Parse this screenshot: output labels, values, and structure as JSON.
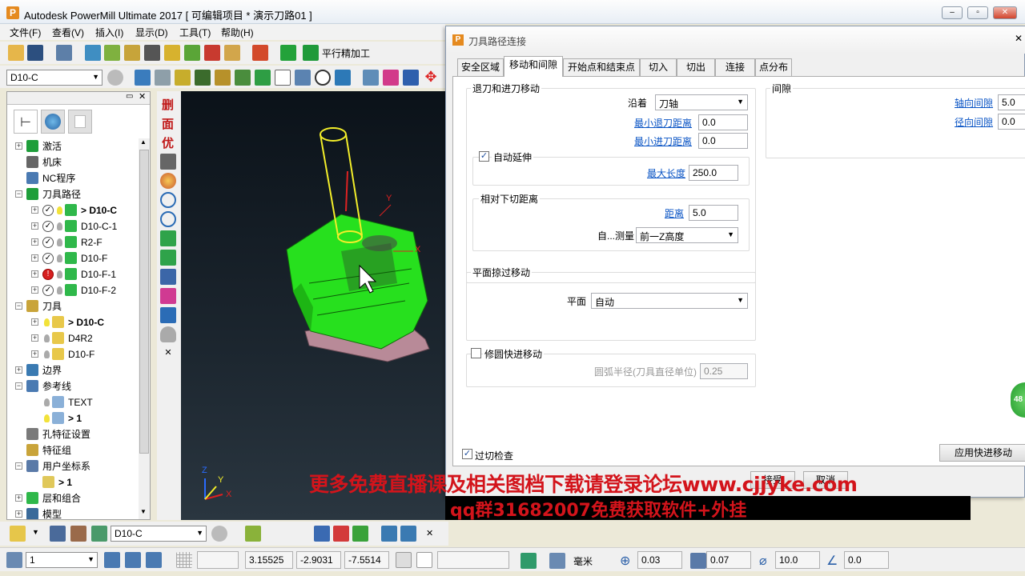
{
  "window": {
    "title": "Autodesk PowerMill Ultimate 2017    [ 可编辑项目 * 演示刀路01 ]",
    "app_icon_letter": "P"
  },
  "menu": [
    "文件(F)",
    "查看(V)",
    "插入(I)",
    "显示(D)",
    "工具(T)",
    "帮助(H)"
  ],
  "toolbar": {
    "strategy_label": "平行精加工",
    "tool_combo": "D10-C"
  },
  "vertical_toolbar_text": [
    "删",
    "面",
    "优"
  ],
  "explorer": {
    "items": [
      {
        "label": "激活",
        "bold": false
      },
      {
        "label": "机床",
        "bold": false
      },
      {
        "label": "NC程序",
        "bold": false
      },
      {
        "label": "刀具路径",
        "bold": false
      },
      {
        "label": "> D10-C",
        "bold": true
      },
      {
        "label": "D10-C-1",
        "bold": false
      },
      {
        "label": "R2-F",
        "bold": false
      },
      {
        "label": "D10-F",
        "bold": false
      },
      {
        "label": "D10-F-1",
        "bold": false
      },
      {
        "label": "D10-F-2",
        "bold": false
      },
      {
        "label": "刀具",
        "bold": false
      },
      {
        "label": "> D10-C",
        "bold": true
      },
      {
        "label": "D4R2",
        "bold": false
      },
      {
        "label": "D10-F",
        "bold": false
      },
      {
        "label": "边界",
        "bold": false
      },
      {
        "label": "参考线",
        "bold": false
      },
      {
        "label": "TEXT",
        "bold": false
      },
      {
        "label": "> 1",
        "bold": true
      },
      {
        "label": "孔特征设置",
        "bold": false
      },
      {
        "label": "特征组",
        "bold": false
      },
      {
        "label": "用户坐标系",
        "bold": false
      },
      {
        "label": "> 1",
        "bold": true
      },
      {
        "label": "层和组合",
        "bold": false
      },
      {
        "label": "模型",
        "bold": false
      }
    ]
  },
  "dialog": {
    "title": "刀具路径连接",
    "tabs": [
      "安全区域",
      "移动和间隙",
      "开始点和结束点",
      "切入",
      "切出",
      "连接",
      "点分布"
    ],
    "active_tab": "移动和间隙",
    "retract_group": {
      "title": "退刀和进刀移动",
      "along_label": "沿着",
      "along_value": "刀轴",
      "min_retract_label": "最小退刀距离",
      "min_retract_value": "0.0",
      "min_approach_label": "最小进刀距离",
      "min_approach_value": "0.0",
      "auto_extend_label": "自动延伸",
      "auto_extend_checked": true,
      "max_length_label": "最大长度",
      "max_length_value": "250.0"
    },
    "relative_group": {
      "title": "相对下切距离",
      "distance_label": "距离",
      "distance_value": "5.0",
      "measure_label": "自...测量",
      "measure_value": "前一Z高度"
    },
    "clearance_group": {
      "title": "间隙",
      "axial_label": "轴向间隙",
      "axial_value": "5.0",
      "radial_label": "径向间隙",
      "radial_value": "0.0"
    },
    "plane_group": {
      "title": "平面掠过移动",
      "plane_label": "平面",
      "plane_value": "自动"
    },
    "arc_group": {
      "title": "修圆快进移动",
      "checked": false,
      "radius_label": "圆弧半径(刀具直径单位)",
      "radius_value": "0.25"
    },
    "gouge_check_label": "过切检查",
    "gouge_check_checked": true,
    "apply_button": "应用快进移动",
    "bottom_hint": "接受",
    "cancel_hint": "取消"
  },
  "watermark": {
    "line1": "更多免费直播课及相关图档下载请登录论坛www.cjjyke.com",
    "line2": "qq群31682007免费获取软件+外挂",
    "color": "#d3141b"
  },
  "axes_triad": {
    "z": "Z",
    "y": "Y",
    "x": "X"
  },
  "bottom_toolbar": {
    "tool_combo": "D10-C"
  },
  "status_bar": {
    "layer_value": "1",
    "coord_x": "3.15525",
    "coord_y": "-2.9031",
    "coord_z": "-7.5514",
    "units": "毫米",
    "tolerance": "0.03",
    "thickness": "0.07",
    "tool_dia": "10.0",
    "angle": "0.0"
  },
  "side_badge": "48"
}
